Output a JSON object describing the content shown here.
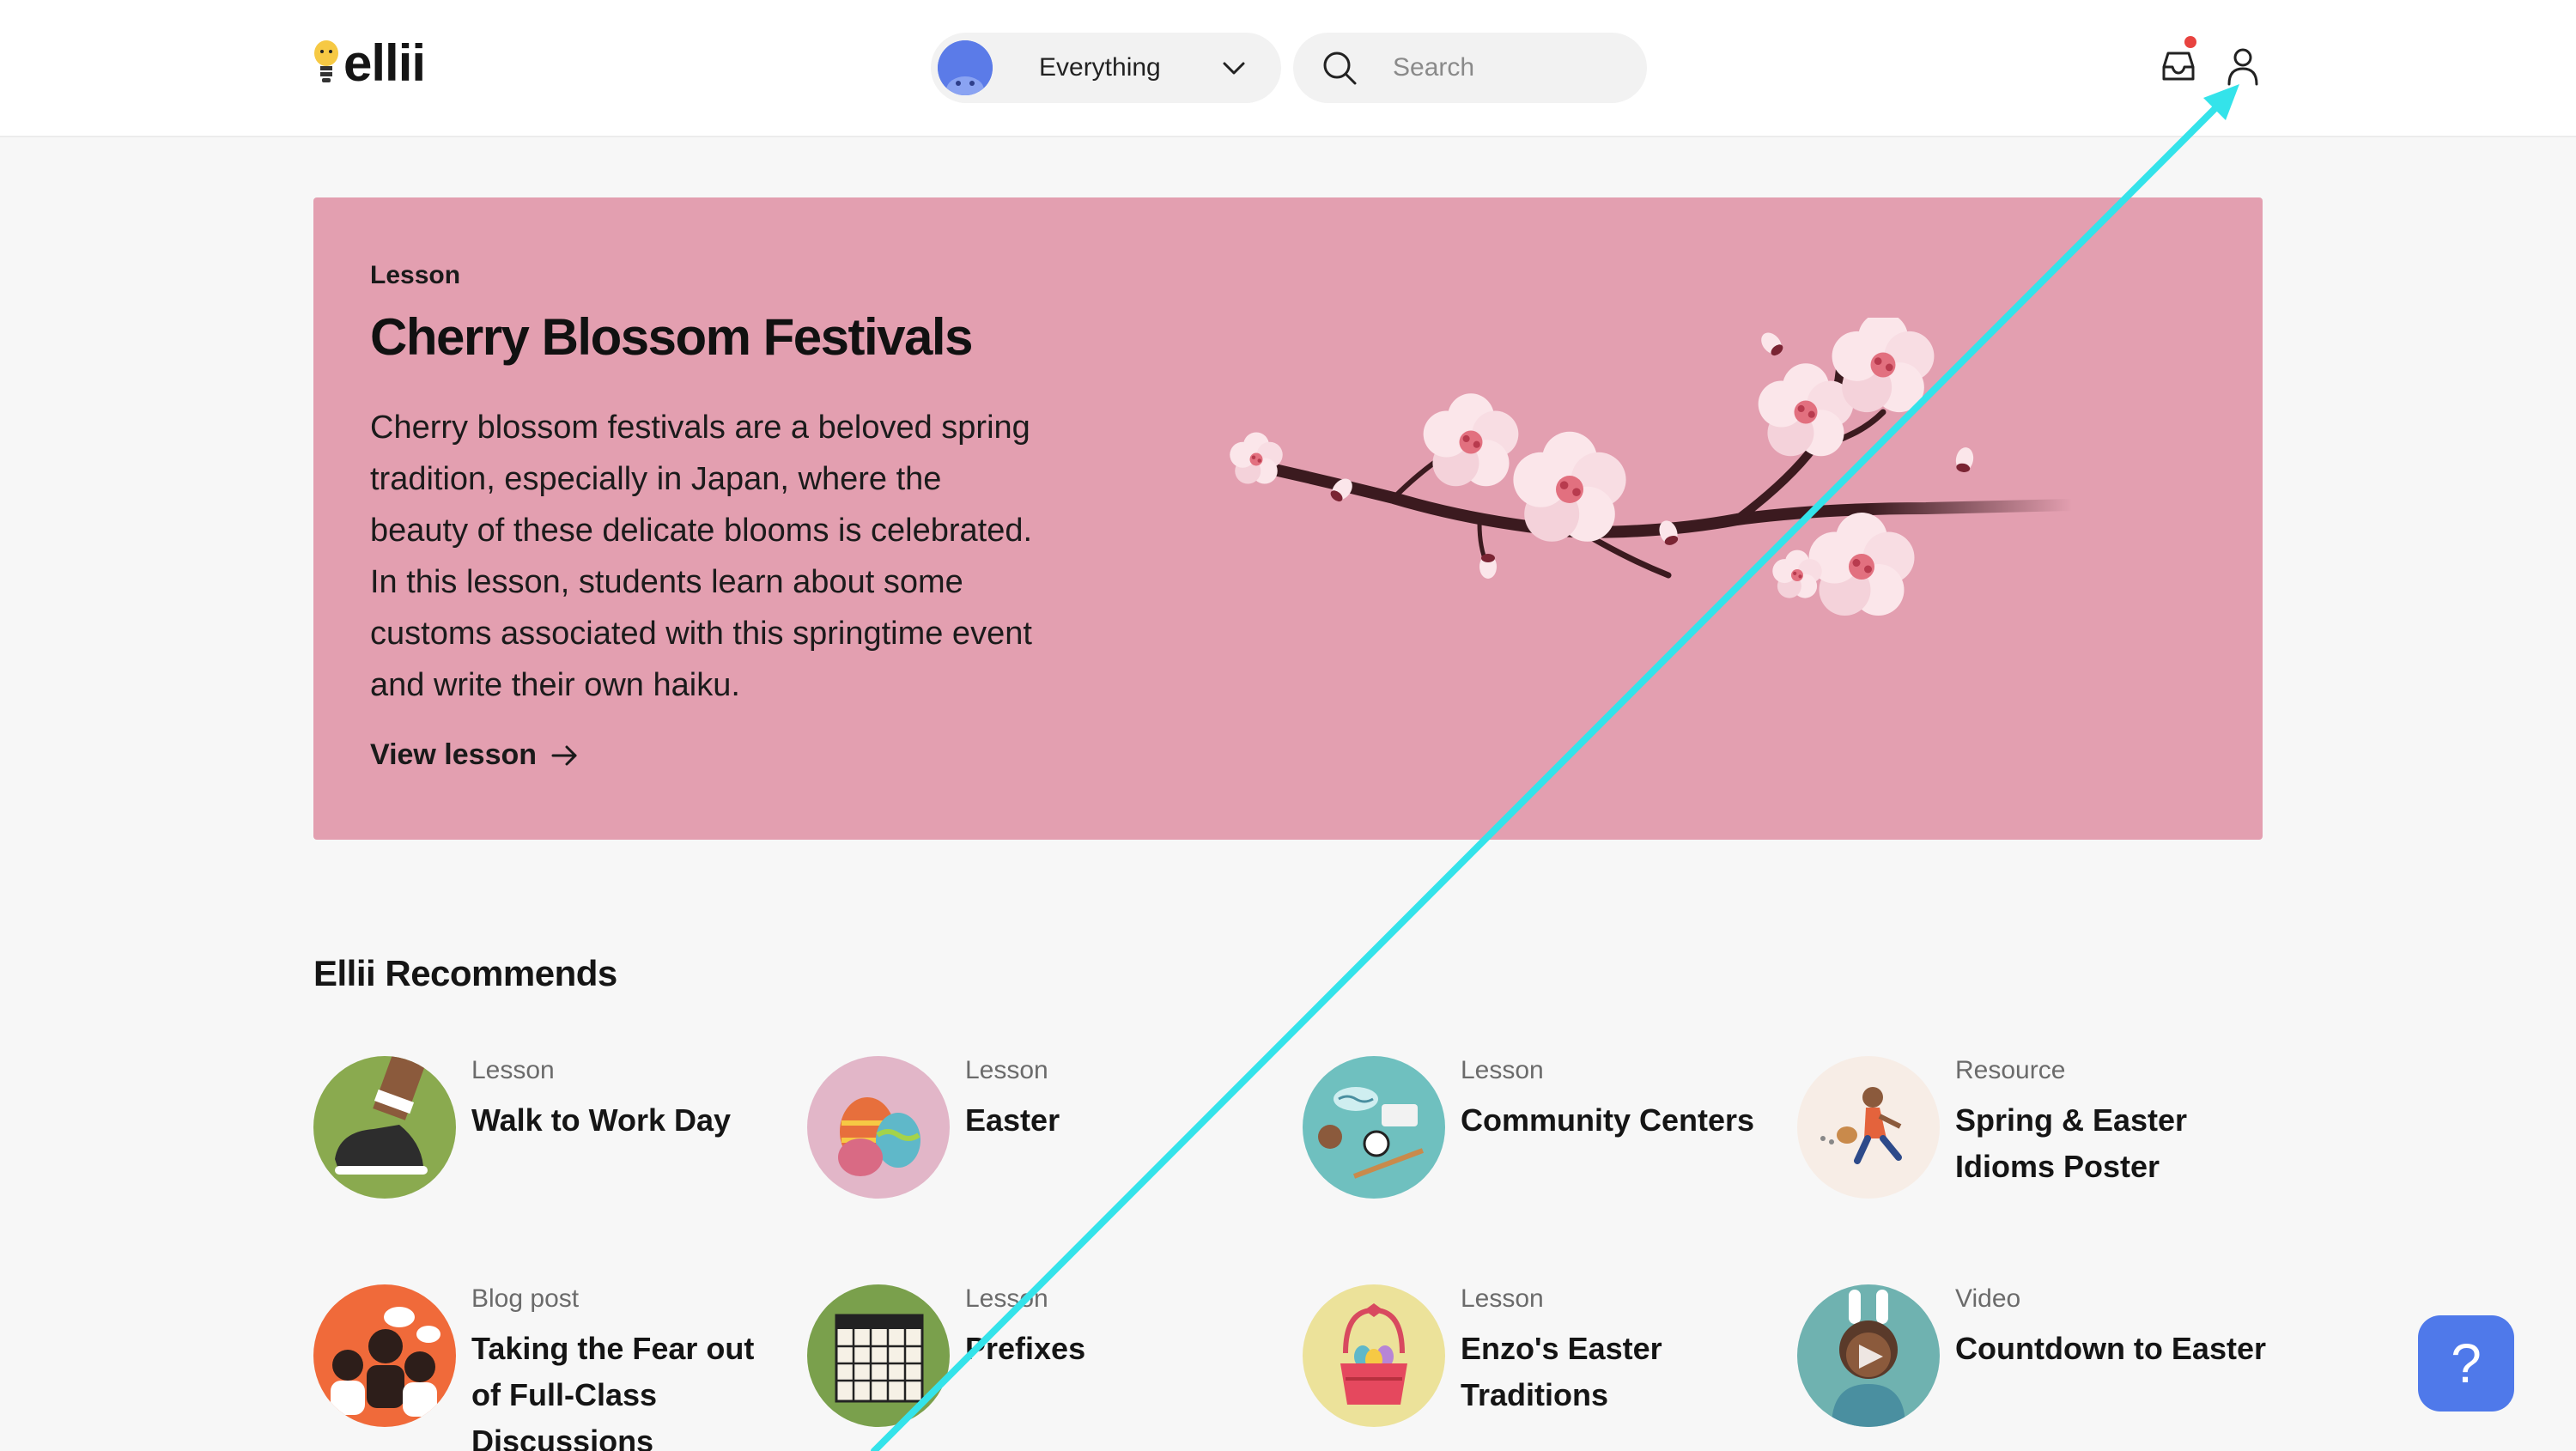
{
  "header": {
    "logo_text": "ellii",
    "filter_label": "Everything",
    "search_placeholder": "Search"
  },
  "hero": {
    "kind": "Lesson",
    "title": "Cherry Blossom Festivals",
    "description": "Cherry blossom festivals are a beloved spring tradition, especially in Japan, where the beauty of these delicate blooms is celebrated. In this lesson, students learn about some customs associated with this springtime event and write their own haiku.",
    "link_label": "View lesson",
    "background": "#e39fb0"
  },
  "recommends": {
    "title": "Ellii Recommends",
    "items": [
      {
        "kind": "Lesson",
        "title": "Walk to Work Day",
        "icon": "sneaker-icon",
        "color": "#8aaa4f"
      },
      {
        "kind": "Lesson",
        "title": "Easter",
        "icon": "easter-eggs-icon",
        "color": "#e2b6c8"
      },
      {
        "kind": "Lesson",
        "title": "Community Centers",
        "icon": "community-icon",
        "color": "#6fc0bf"
      },
      {
        "kind": "Resource",
        "title": "Spring & Easter Idioms Poster",
        "icon": "egg-hunt-icon",
        "color": "#f7ede6"
      },
      {
        "kind": "Blog post",
        "title": "Taking the Fear out of Full-Class Discussions",
        "icon": "discussion-icon",
        "color": "#f06a3a"
      },
      {
        "kind": "Lesson",
        "title": "Prefixes",
        "icon": "grid-icon",
        "color": "#7aa04c"
      },
      {
        "kind": "Lesson",
        "title": "Enzo's Easter Traditions",
        "icon": "easter-basket-icon",
        "color": "#ece29a"
      },
      {
        "kind": "Video",
        "title": "Countdown to Easter",
        "icon": "bunny-kid-icon",
        "color": "#6fb2b0"
      }
    ]
  },
  "help": {
    "label": "?"
  },
  "colors": {
    "accent": "#4f79ea",
    "trace": "#34e3ea",
    "notification": "#e8433f"
  }
}
